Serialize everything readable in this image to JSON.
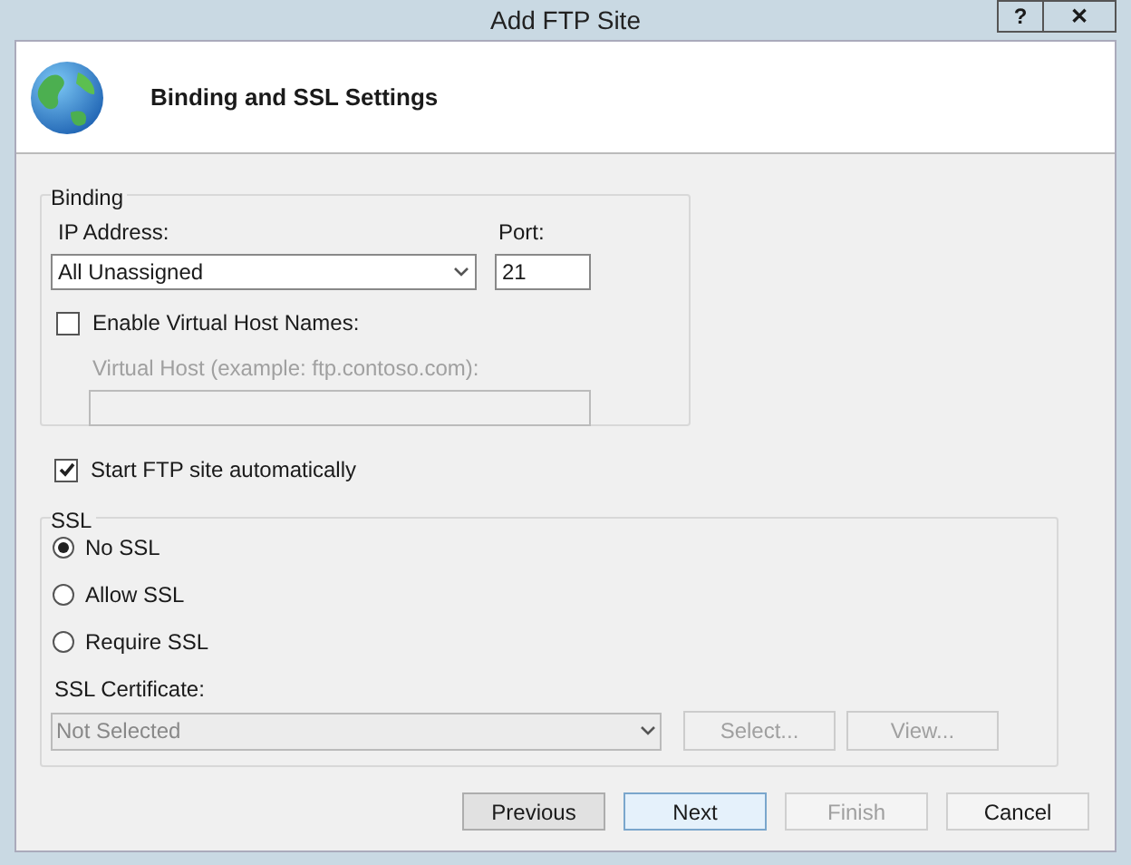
{
  "window": {
    "title": "Add FTP Site",
    "title_buttons": [
      "?",
      "✕"
    ]
  },
  "header": {
    "title": "Binding and SSL Settings"
  },
  "binding": {
    "legend": "Binding",
    "ip_label": "IP Address:",
    "ip_value": "All Unassigned",
    "port_label": "Port:",
    "port_value": "21",
    "virtual_host": {
      "label": "Enable Virtual Host Names:",
      "checked": false
    },
    "virtual_host_field": {
      "label": "Virtual Host (example: ftp.contoso.com):",
      "disabled": true
    }
  },
  "start_automatically": {
    "label": "Start FTP site automatically",
    "checked": true
  },
  "ssl": {
    "legend": "SSL",
    "options": [
      {
        "label": "No SSL",
        "selected": true
      },
      {
        "label": "Allow SSL",
        "selected": false
      },
      {
        "label": "Require SSL",
        "selected": false
      }
    ],
    "certificate_label": "SSL Certificate:",
    "certificate_value": "Not Selected",
    "certificate_disabled": true,
    "buttons": [
      {
        "label": "Select...",
        "disabled": true
      },
      {
        "label": "View...",
        "disabled": true
      }
    ]
  },
  "buttons": [
    {
      "label": "Previous",
      "disabled": false,
      "kind": "gray"
    },
    {
      "label": "Next",
      "disabled": false,
      "kind": "default"
    },
    {
      "label": "Finish",
      "disabled": true,
      "kind": "plain"
    },
    {
      "label": "Cancel",
      "disabled": false,
      "kind": "plain"
    }
  ]
}
